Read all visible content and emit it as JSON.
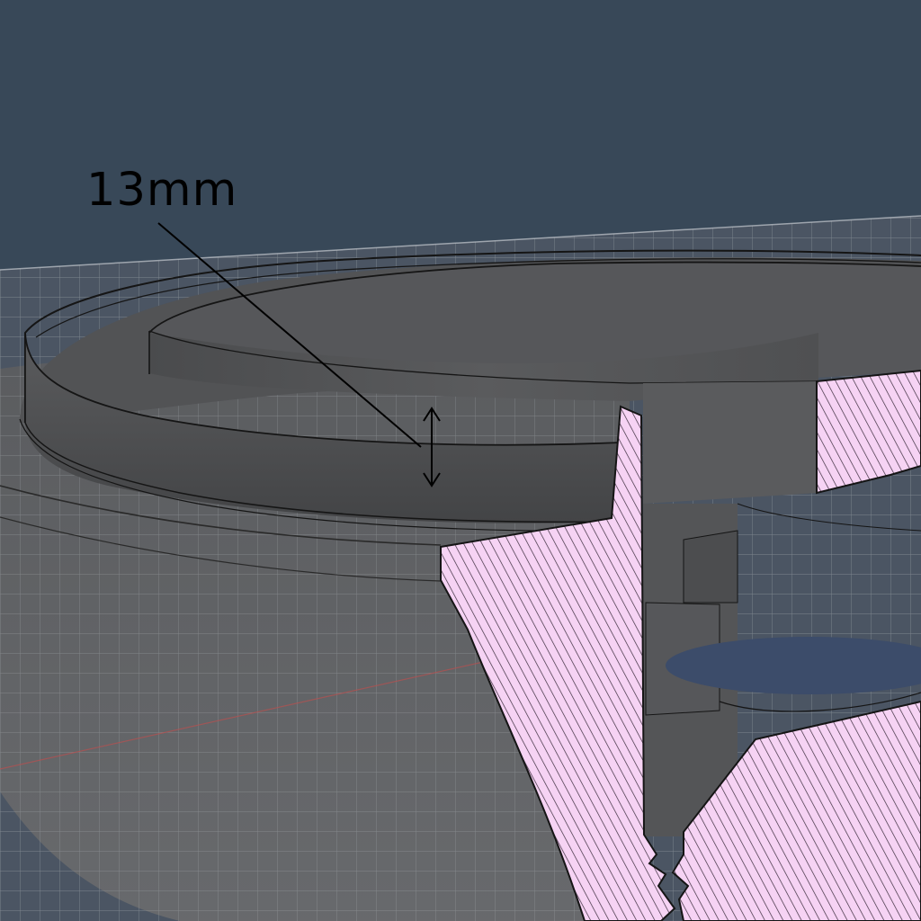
{
  "dimension": {
    "label": "13mm"
  },
  "colors": {
    "background": "#384858",
    "grid_plane": "#5c6066",
    "grid_lines": "#a3a8ad",
    "model_gray": "#4f5052",
    "section_fill": "#f6d3f4",
    "section_hatch": "#3a2c3c",
    "edge_lines": "#141414",
    "axis_red": "#b85050"
  },
  "icons": {
    "arrow": "double-headed-vertical-arrow-icon"
  }
}
